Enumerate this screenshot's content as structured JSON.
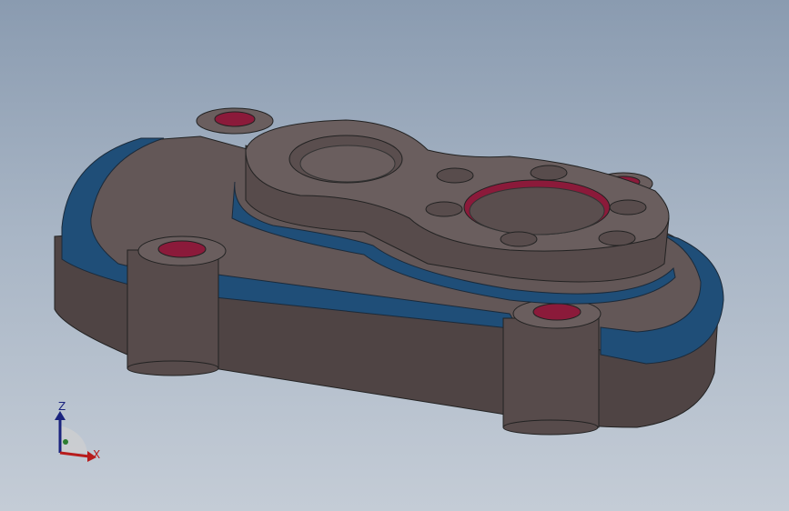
{
  "viewport": {
    "background_top": "#8a9bb0",
    "background_bottom": "#c4ccd6"
  },
  "model": {
    "body_color": "#5a4e4e",
    "top_face_color": "#645858",
    "fillet_color": "#1f4e78",
    "hole_color": "#8b1a3a"
  },
  "triad": {
    "z_label": "Z",
    "x_label": "X",
    "z_color": "#1a237e",
    "x_color": "#b71c1c"
  }
}
